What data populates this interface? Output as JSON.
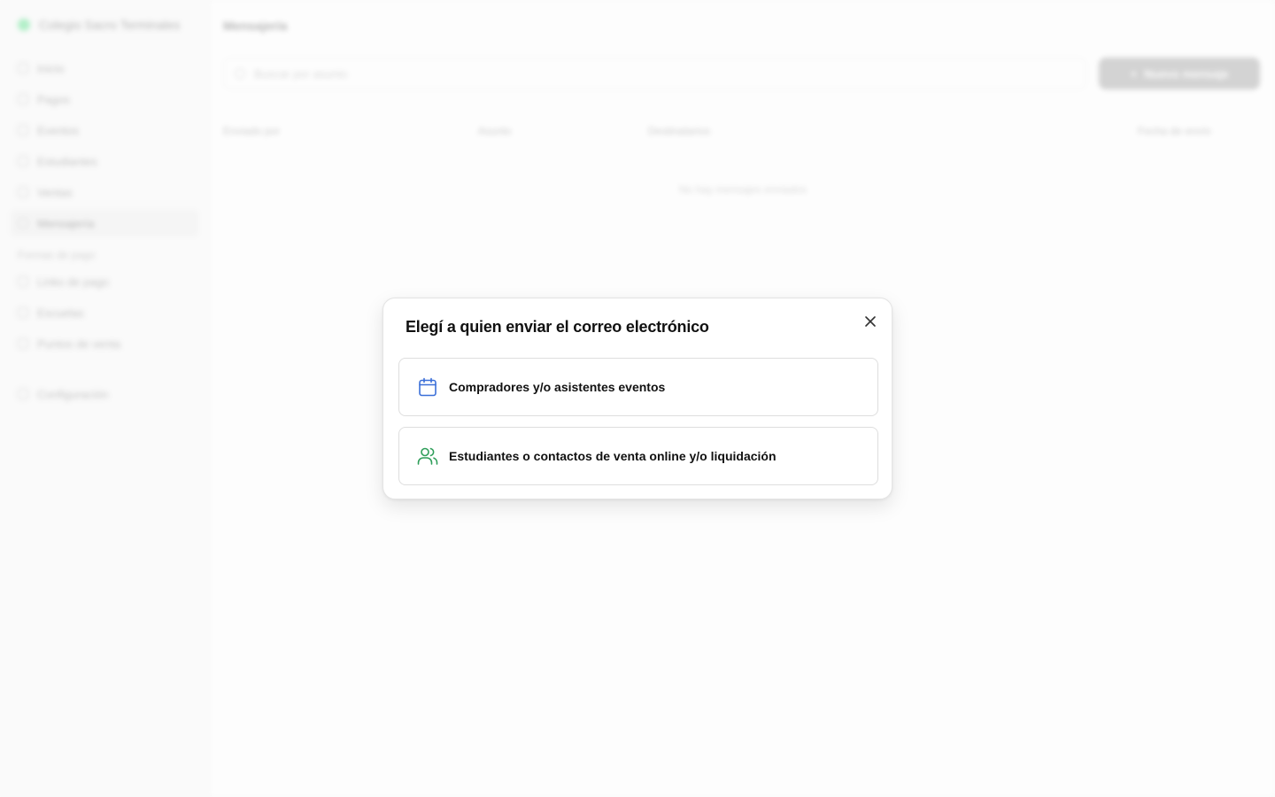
{
  "sidebar": {
    "org_name": "Colegio Sacro Terminales",
    "items": [
      {
        "label": "Inicio",
        "icon": "home-icon"
      },
      {
        "label": "Pagos",
        "icon": "payments-icon"
      },
      {
        "label": "Eventos",
        "icon": "calendar-icon"
      },
      {
        "label": "Estudiantes",
        "icon": "students-icon"
      },
      {
        "label": "Ventas",
        "icon": "sales-icon"
      },
      {
        "label": "Mensajería",
        "icon": "mail-icon",
        "active": true
      }
    ],
    "section_label": "Formas de pago",
    "section_items": [
      {
        "label": "Links de pago",
        "icon": "link-icon"
      },
      {
        "label": "Escuelas",
        "icon": "school-icon"
      },
      {
        "label": "Puntos de venta",
        "icon": "store-icon"
      }
    ],
    "settings_label": "Configuración"
  },
  "main": {
    "title": "Mensajería",
    "search_placeholder": "Buscar por asunto",
    "new_button_label": "Nuevo mensaje",
    "table_headers": [
      "Enviado por",
      "Asunto",
      "Destinatarios",
      "Fecha de envío"
    ],
    "empty_text": "No hay mensajes enviados"
  },
  "modal": {
    "title": "Elegí a quien enviar el correo electrónico",
    "close_icon": "close-icon",
    "options": [
      {
        "label": "Compradores y/o asistentes eventos",
        "icon": "calendar-icon",
        "color": "#3b6fd8"
      },
      {
        "label": "Estudiantes o contactos de venta online y/o liquidación",
        "icon": "users-icon",
        "color": "#2f9e5a"
      }
    ]
  }
}
